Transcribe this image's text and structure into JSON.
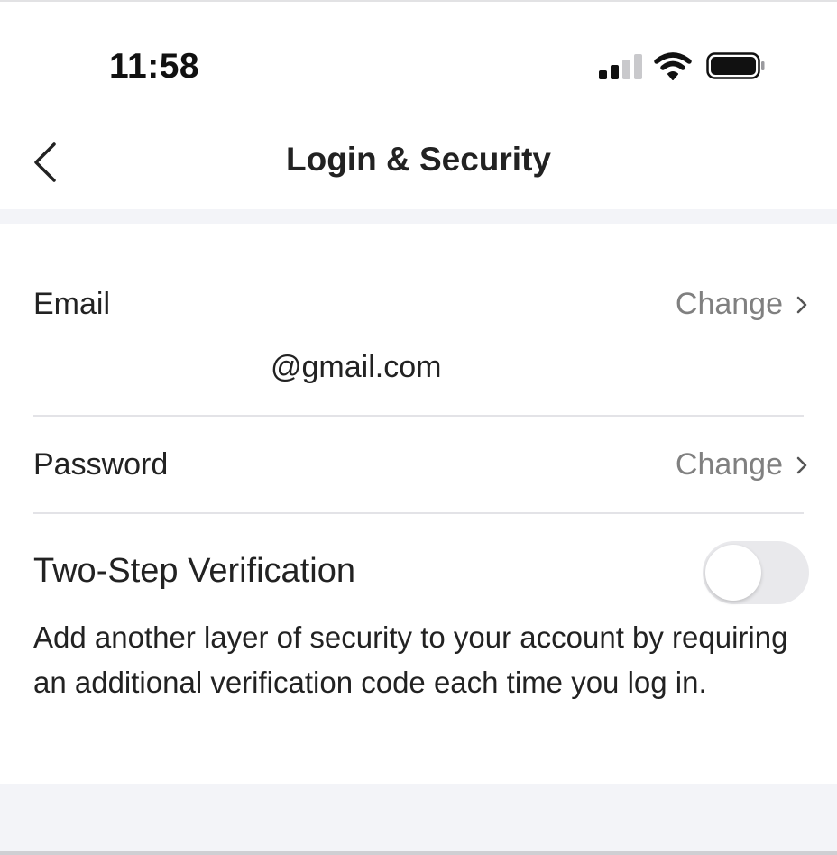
{
  "status_bar": {
    "time": "11:58",
    "icons": [
      "cellular-signal-icon",
      "wifi-icon",
      "battery-icon"
    ]
  },
  "nav": {
    "title": "Login & Security",
    "back_icon": "chevron-left-icon"
  },
  "email": {
    "label": "Email",
    "action_label": "Change",
    "value": "@gmail.com"
  },
  "password": {
    "label": "Password",
    "action_label": "Change"
  },
  "two_step": {
    "label": "Two-Step Verification",
    "enabled": false,
    "description": "Add another layer of security to your account by requiring an additional verification code each time you log in."
  },
  "colors": {
    "background": "#ffffff",
    "section_gray": "#f3f4f8",
    "text_primary": "#222222",
    "text_secondary": "#808080",
    "divider": "#e3e3e7",
    "toggle_off": "#e9e9ec"
  }
}
